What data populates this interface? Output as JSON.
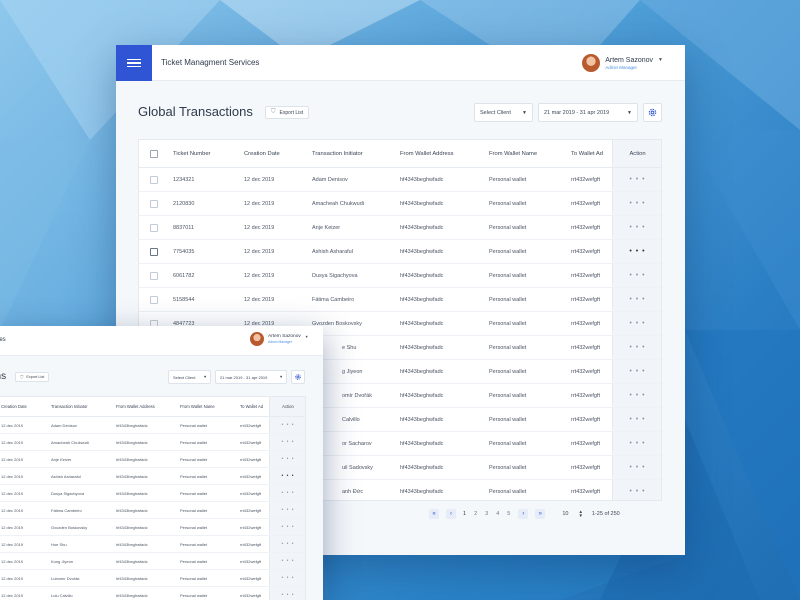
{
  "colors": {
    "accent": "#2f55d4",
    "link": "#4c8fe0",
    "text": "#2f3b4c"
  },
  "app": {
    "title": "Ticket Managment Services",
    "title_partial": "rvices"
  },
  "user": {
    "name": "Artem Sazonov",
    "role": "Admin Manager"
  },
  "page": {
    "title": "Global Transactions",
    "title_partial": "ons"
  },
  "toolbar": {
    "export_label": "Export List",
    "client_select": "Select Client",
    "date_range": "21 mar 2019 - 31 apr 2019",
    "icons": {
      "menu": "menu-icon",
      "settings": "gear-icon",
      "export": "shield-check-icon",
      "dropdown": "caret-down-icon"
    }
  },
  "table": {
    "headers": {
      "ticket": "Ticket Number",
      "date": "Creation Date",
      "initiator": "Transaction Initiator",
      "from_address": "From Wallet Address",
      "from_name": "From Wallet Name",
      "to_address": "To Wallet Address",
      "to_address_clipped": "To Wallet Ad",
      "action": "Action"
    },
    "action_glyph": "• • •",
    "rows": [
      {
        "ticket": "1234321",
        "date": "12 dec 2019",
        "initiator": "Adam Denisov",
        "initiator_clipped": "Adam Denisov",
        "from_address": "hf4343beghwfadc",
        "from_name": "Personal wallet",
        "to_address": "rrt432wefgft"
      },
      {
        "ticket": "2120830",
        "date": "12 dec 2019",
        "initiator": "Amacheah Chukwudi",
        "initiator_clipped": "Amacheah Chukwudi",
        "from_address": "hf4343beghwfadc",
        "from_name": "Personal wallet",
        "to_address": "rrt432wefgft"
      },
      {
        "ticket": "8837011",
        "date": "12 dec 2019",
        "initiator": "Anje Keizer",
        "initiator_clipped": "Anje Keizer",
        "from_address": "hf4343beghwfadc",
        "from_name": "Personal wallet",
        "to_address": "rrt432wefgft"
      },
      {
        "ticket": "7754035",
        "date": "12 dec 2019",
        "initiator": "Ashish Asharaful",
        "initiator_clipped": "Ashish Asharaful",
        "from_address": "hf4343beghwfadc",
        "from_name": "Personal wallet",
        "to_address": "rrt432wefgft"
      },
      {
        "ticket": "6061782",
        "date": "12 dec 2019",
        "initiator": "Dusya Sigachyova",
        "initiator_clipped": "Dusya Sigachyova",
        "from_address": "hf4343beghwfadc",
        "from_name": "Personal wallet",
        "to_address": "rrt432wefgft"
      },
      {
        "ticket": "5158544",
        "date": "12 dec 2019",
        "initiator": "Fátima Cambeiro",
        "initiator_clipped": "Fátima Cambeiro",
        "from_address": "hf4343beghwfadc",
        "from_name": "Personal wallet",
        "to_address": "rrt432wefgft"
      },
      {
        "ticket": "4847723",
        "date": "12 dec 2019",
        "initiator": "Gvozden Boskovsky",
        "initiator_clipped": "Gvozden Boskovsky",
        "from_address": "hf4343beghwfadc",
        "from_name": "Personal wallet",
        "to_address": "rrt432wefgft"
      },
      {
        "ticket": "",
        "date": "12 dec 2019",
        "initiator": "Hue Shu",
        "initiator_clipped": "e Shu",
        "from_address": "hf4343beghwfadc",
        "from_name": "Personal wallet",
        "to_address": "rrt432wefgft"
      },
      {
        "ticket": "",
        "date": "12 dec 2019",
        "initiator": "Kung Jiyeon",
        "initiator_clipped": "g Jiyeon",
        "from_address": "hf4343beghwfadc",
        "from_name": "Personal wallet",
        "to_address": "rrt432wefgft"
      },
      {
        "ticket": "",
        "date": "12 dec 2019",
        "initiator": "Lubomír Dvořák",
        "initiator_clipped": "omír Dvořák",
        "from_address": "hf4343beghwfadc",
        "from_name": "Personal wallet",
        "to_address": "rrt432wefgft"
      },
      {
        "ticket": "",
        "date": "12 dec 2019",
        "initiator": "Lulu Calvillo",
        "initiator_clipped": "Calvillo",
        "from_address": "hf4343beghwfadc",
        "from_name": "Personal wallet",
        "to_address": "rrt432wefgft"
      },
      {
        "ticket": "",
        "date": "",
        "initiator": "",
        "initiator_clipped": "or Sacharov",
        "from_address": "hf4343beghwfadc",
        "from_name": "Personal wallet",
        "to_address": "rrt432wefgft"
      },
      {
        "ticket": "",
        "date": "",
        "initiator": "",
        "initiator_clipped": "uil Sadovsky",
        "from_address": "hf4343beghwfadc",
        "from_name": "Personal wallet",
        "to_address": "rrt432wefgft"
      },
      {
        "ticket": "",
        "date": "",
        "initiator": "",
        "initiator_clipped": "anh Đức",
        "from_address": "hf4343beghwfadc",
        "from_name": "Personal wallet",
        "to_address": "rrt432wefgft"
      }
    ]
  },
  "pagination": {
    "first_icon": "first-page-icon",
    "prev_icon": "chevron-left-icon",
    "next_icon": "chevron-right-icon",
    "last_icon": "last-page-icon",
    "pages": [
      "1",
      "2",
      "3",
      "4",
      "5"
    ],
    "current": "1",
    "page_size": "10",
    "range": "1-25 of 250"
  }
}
